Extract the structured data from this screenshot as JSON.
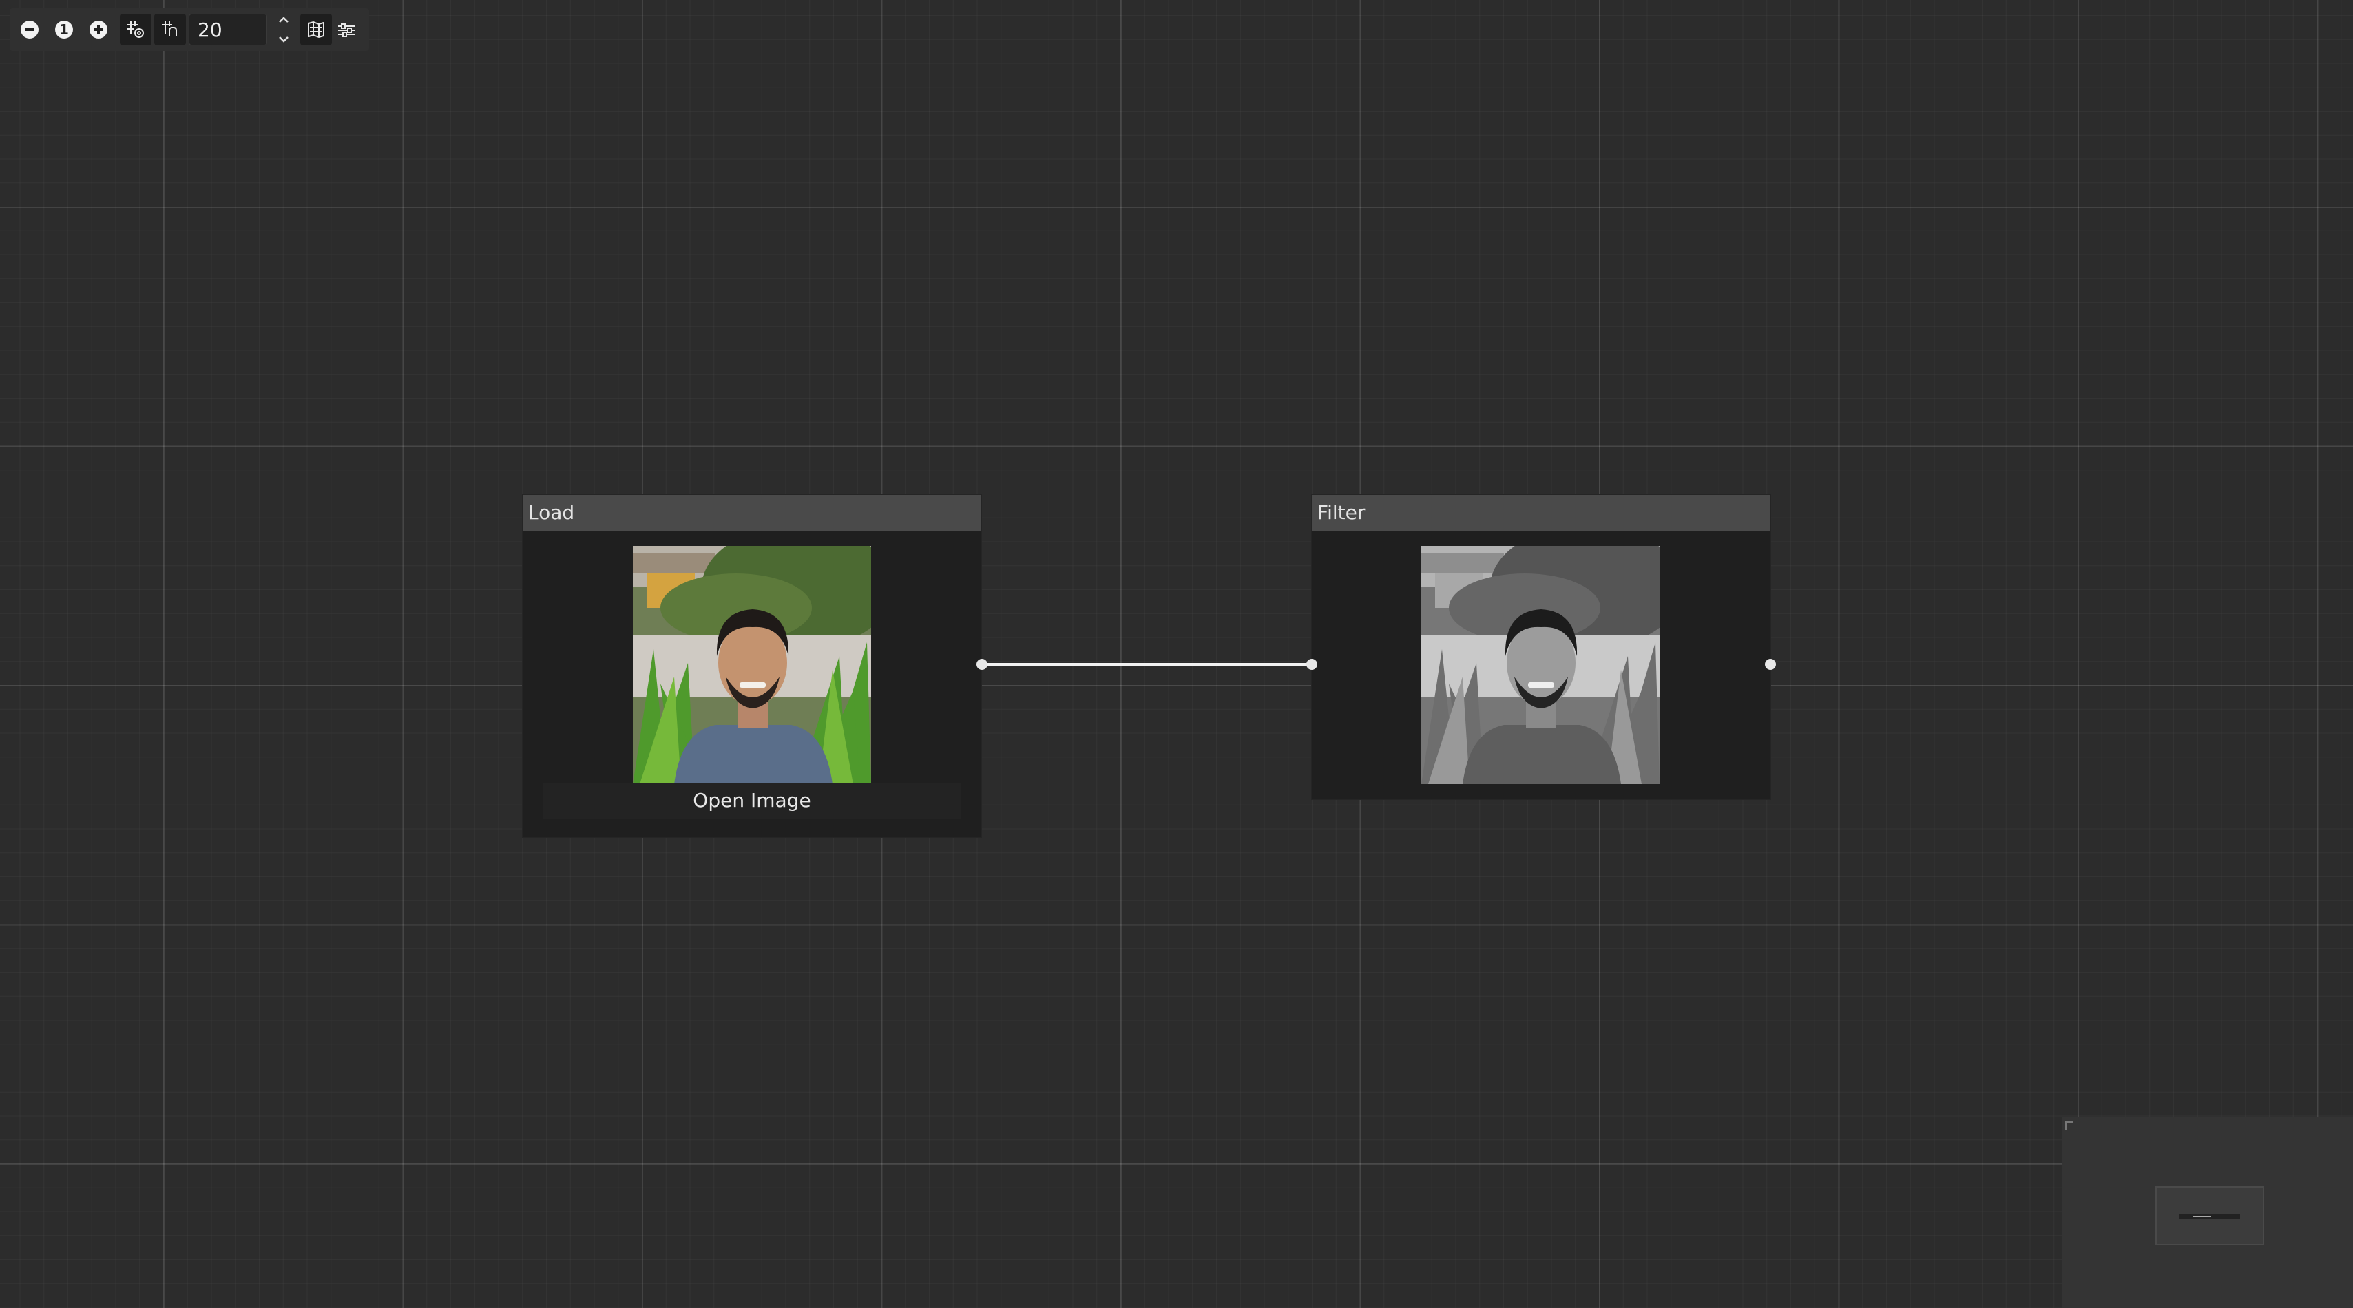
{
  "toolbar": {
    "zoom_out_icon": "zoom-out-icon",
    "reset_zoom_label": "1",
    "zoom_in_icon": "zoom-in-icon",
    "snap_grid_icon": "snap-grid-icon",
    "snap_node_icon": "snap-node-icon",
    "grid_size_value": "20",
    "minimap_toggle_icon": "minimap-icon",
    "settings_icon": "sliders-icon"
  },
  "nodes": [
    {
      "title": "Load",
      "image": "color-portrait-photo",
      "button_label": "Open Image"
    },
    {
      "title": "Filter",
      "image": "grayscale-portrait-photo"
    }
  ],
  "colors": {
    "canvas_bg": "#2c2c2c",
    "node_header": "#4a4a4a",
    "node_body": "#1f1f1f",
    "link": "#f2f2f2"
  }
}
